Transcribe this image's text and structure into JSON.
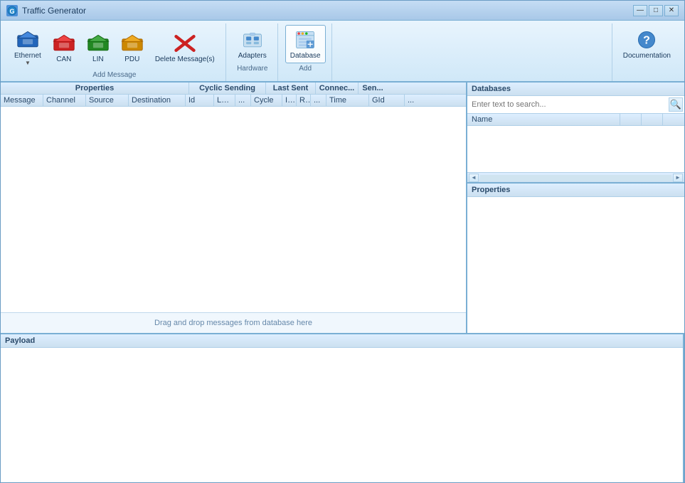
{
  "window": {
    "title": "Traffic Generator",
    "icon": "⚡"
  },
  "titlebar": {
    "minimize": "—",
    "maximize": "□",
    "close": "✕"
  },
  "toolbar": {
    "addMessageGroup": "Add Message",
    "hardwareGroup": "Hardware",
    "addGroup": "Add",
    "buttons": {
      "ethernet": {
        "label": "Ethernet",
        "icon": "✉",
        "hasDropdown": true
      },
      "can": {
        "label": "CAN",
        "icon": "✉"
      },
      "lin": {
        "label": "LIN",
        "icon": "✉"
      },
      "pdu": {
        "label": "PDU",
        "icon": "✉"
      },
      "delete": {
        "label": "Delete Message(s)",
        "icon": "✕"
      },
      "adapters": {
        "label": "Adapters",
        "icon": "⬛"
      },
      "database": {
        "label": "Database",
        "icon": "🗄"
      },
      "documentation": {
        "label": "Documentation",
        "icon": "?"
      }
    }
  },
  "table": {
    "groupHeaders": [
      {
        "label": "Properties",
        "colspan": 5
      },
      {
        "label": "Cyclic Sending",
        "colspan": 5
      },
      {
        "label": "Last Sent",
        "colspan": 1
      },
      {
        "label": "Connec...",
        "colspan": 1
      },
      {
        "label": "Sen...",
        "colspan": 1
      }
    ],
    "columnHeaders": [
      "Message",
      "Channel",
      "Source",
      "Destination",
      "Id",
      "Le...",
      "...",
      "Cycle",
      "I...",
      "R...",
      "...",
      "Time",
      "GId",
      "..."
    ],
    "dragDropMessage": "Drag and drop messages from database here"
  },
  "payload": {
    "title": "Payload"
  },
  "databases": {
    "title": "Databases",
    "searchPlaceholder": "Enter text to search...",
    "searchIcon": "🔍",
    "columns": [
      "Name"
    ],
    "scrollLeft": "◄",
    "scrollRight": "►"
  },
  "properties": {
    "title": "Properties"
  }
}
